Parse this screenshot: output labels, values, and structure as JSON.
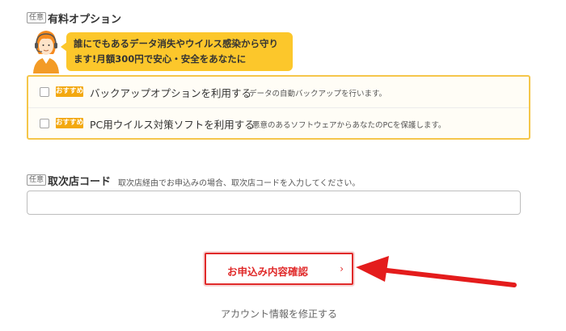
{
  "paid_options": {
    "tag": "任意",
    "title": "有料オプション",
    "bubble_line1": "誰にでもあるデータ消失やウイルス感染から守り",
    "bubble_line2": "ます!月額300円で安心・安全をあなたに",
    "items": [
      {
        "badge": "おすすめ",
        "label": "バックアップオプションを利用する",
        "desc": "データの自動バックアップを行います。",
        "checked": false
      },
      {
        "badge": "おすすめ",
        "label": "PC用ウイルス対策ソフトを利用する",
        "desc": "悪意のあるソフトウェアからあなたのPCを保護します。",
        "checked": false
      }
    ]
  },
  "agency": {
    "tag": "任意",
    "title": "取次店コード",
    "note": "取次店経由でお申込みの場合、取次店コードを入力してください。",
    "value": ""
  },
  "confirm": {
    "label": "お申込み内容確認",
    "chevron": "›"
  },
  "fix_link": "アカウント情報を修正する",
  "colors": {
    "accent_red": "#e02a2a",
    "bubble_yellow": "#fcc72b",
    "badge_orange": "#f3a80f"
  },
  "icons": {
    "operator": "headset-operator-icon",
    "arrow": "red-arrow-icon"
  }
}
